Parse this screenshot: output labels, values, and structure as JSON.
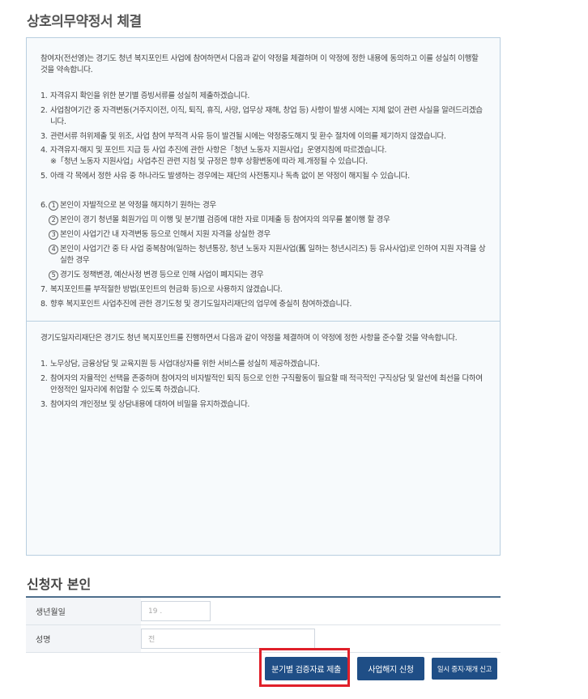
{
  "section_title": "상호의무약정서 체결",
  "participant_intro": "참여자(전선영)는 경기도 청년 복지포인트 사업에 참여하면서 다음과 같이 약정을 체결하며 이 약정에 정한 내용에 동의하고 이를 성실히 이행할 것을 약속합니다.",
  "participant_items": [
    {
      "num": "1.",
      "text": "자격유지 확인을 위한 분기별 증빙서류를 성실히 제출하겠습니다."
    },
    {
      "num": "2.",
      "text": "사업참여기간 중 자격변동(거주지이전, 이직, 퇴직, 휴직, 사망, 업무상 재해, 창업 등) 사항이 발생 시에는 지체 없이 관련 사실을 알려드리겠습니다."
    },
    {
      "num": "3.",
      "text": "관련서류 허위제출 및 위조, 사업 참여 부적격 사유 등이 발견될 시에는 약정중도해지 및 환수 절차에 이의를 제기하지 않겠습니다."
    },
    {
      "num": "4.",
      "text": "자격유지·해지 및 포인트 지급 등 사업 추진에 관한 사항은「청년 노동자 지원사업」운영지침에 따르겠습니다.",
      "note": "※「청년 노동자 지원사업」사업추진 관련 지침 및 규정은 향후 상황변동에 따라 제.개정될 수 있습니다."
    },
    {
      "num": "5.",
      "text": "아래 각 목에서 정한 사유 중 하나라도 발생하는 경우에는 재단의 사전통지나 독촉 없이 본 약정이 해지될 수 있습니다."
    }
  ],
  "item6_num": "6.",
  "item6_subs": [
    {
      "mark": "1",
      "text": "본인이 자발적으로 본 약정을 해지하기 원하는 경우"
    },
    {
      "mark": "2",
      "text": "본인이 경기 청년몰 회원가입 미 이행 및 분기별 검증에 대한 자료 미제출 등 참여자의 의무를 불이행 할 경우"
    },
    {
      "mark": "3",
      "text": "본인이 사업기간 내 자격변동 등으로 인해서 지원 자격을 상실한 경우"
    },
    {
      "mark": "4",
      "text": "본인이 사업기간 중 타 사업 중복참여(일하는 청년통장, 청년 노동자 지원사업(舊 일하는 청년시리즈) 등 유사사업)로 인하여 지원 자격을 상실한 경우"
    },
    {
      "mark": "5",
      "text": "경기도 정책변경, 예산사정 변경 등으로 인해 사업이 폐지되는 경우"
    }
  ],
  "participant_items_tail": [
    {
      "num": "7.",
      "text": "복지포인트를 부적절한 방법(포인트의 현금화 등)으로 사용하지 않겠습니다."
    },
    {
      "num": "8.",
      "text": "향후 복지포인트 사업추진에 관한 경기도청 및 경기도일자리재단의 업무에 충실히 참여하겠습니다."
    }
  ],
  "foundation_intro": "경기도일자리재단은 경기도 청년 복지포인트를 진행하면서 다음과 같이 약정을 체결하며 이 약정에 정한 사항을 준수할 것을 약속합니다.",
  "foundation_items": [
    {
      "num": "1.",
      "text": "노무상담, 금융상담 및 교육지원 등 사업대상자를 위한 서비스를 성실히 제공하겠습니다."
    },
    {
      "num": "2.",
      "text": "참여자의 자율적인 선택을 존중하며 참여자의 비자발적인 퇴직 등으로 인한 구직활동이 필요할 때 적극적인 구직상담 및 알선에 최선을 다하여 안정적인 일자리에 취업할 수 있도록 하겠습니다."
    },
    {
      "num": "3.",
      "text": "참여자의 개인정보 및 상담내용에 대하여 비밀을 유지하겠습니다."
    }
  ],
  "applicant": {
    "title": "신청자 본인",
    "birth_label": "생년월일",
    "birth_value": "19  .",
    "name_label": "성명",
    "name_value": "전"
  },
  "buttons": {
    "submit": "분기별 검증자료 제출",
    "cancel": "사업해지 신청",
    "pause": "일시 중지·재개 신고"
  }
}
